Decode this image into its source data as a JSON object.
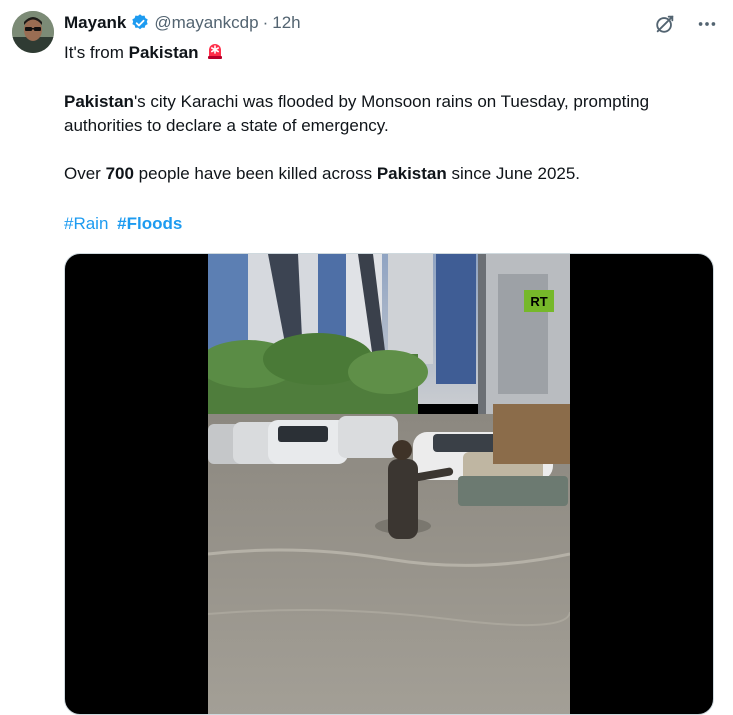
{
  "user": {
    "name": "Mayank",
    "handle": "@mayankcdp",
    "separator": "·",
    "time": "12h"
  },
  "first_line": {
    "prefix": "It's from ",
    "bold": "Pakistan",
    "emoji_icon": "siren-icon"
  },
  "paragraph1": {
    "bold_start": "Pakistan",
    "rest": "'s city Karachi was flooded by Monsoon rains on Tuesday, prompting authorities to declare a state of emergency."
  },
  "paragraph2": {
    "p1": "Over ",
    "b1": "700",
    "p2": " people have been killed across ",
    "b2": "Pakistan",
    "p3": " since June 2025."
  },
  "hashtags": {
    "rain": "#Rain",
    "floods": "#Floods"
  },
  "media": {
    "watermark": "RT"
  },
  "colors": {
    "link": "#1d9bf0",
    "secondary_text": "#536471",
    "verified": "#1d9bf0",
    "watermark_bg": "#76b82a"
  }
}
